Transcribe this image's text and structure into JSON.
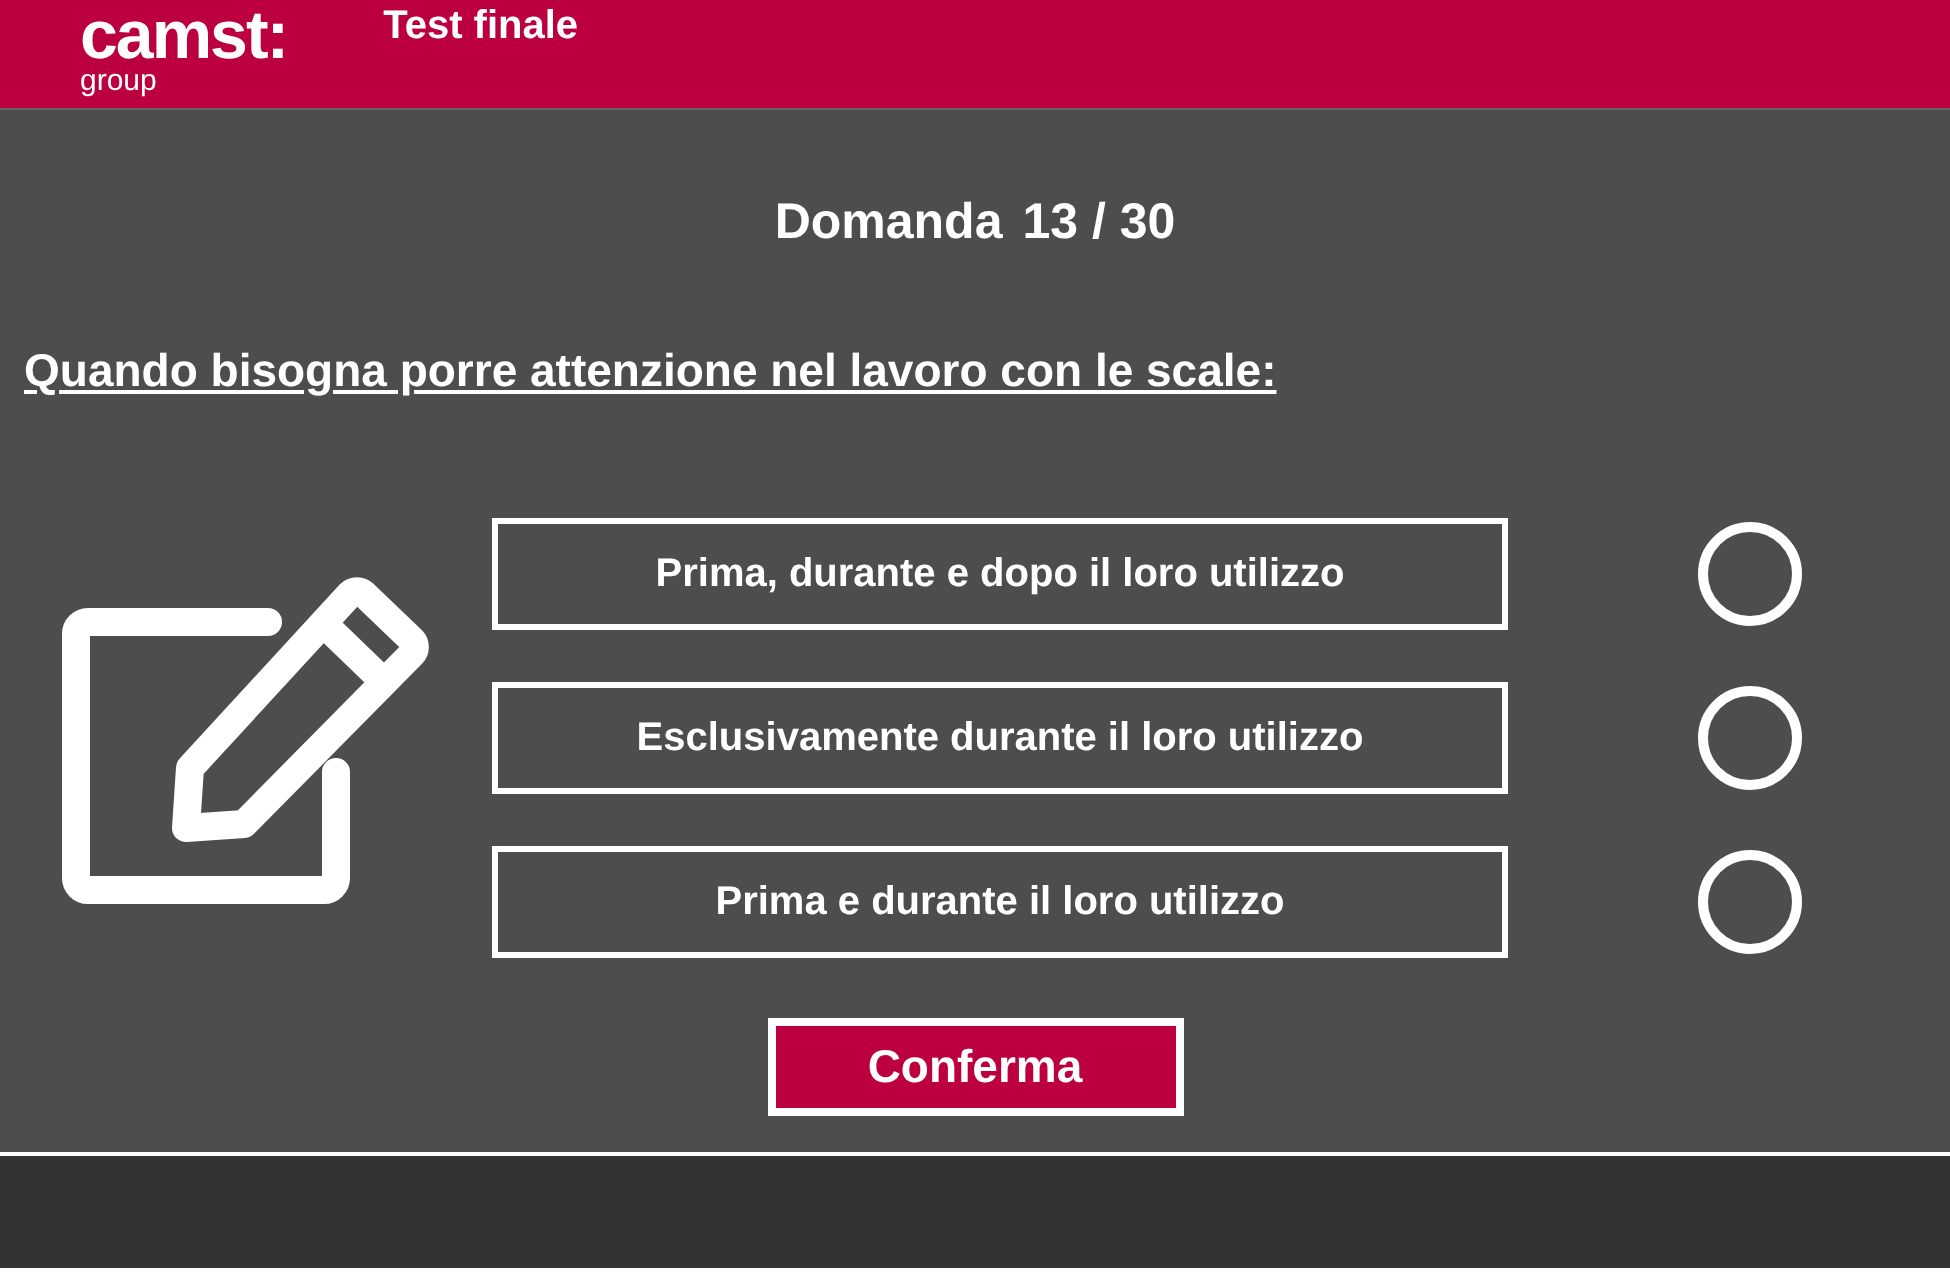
{
  "header": {
    "logo": "camst:",
    "logo_sub": "group",
    "title": "Test finale"
  },
  "question_counter": {
    "label": "Domanda",
    "value": "13 / 30"
  },
  "question": "Quando bisogna porre attenzione nel lavoro con le scale:",
  "answers": [
    {
      "text": "Prima, durante e dopo il loro utilizzo",
      "selected": false
    },
    {
      "text": "Esclusivamente durante il loro utilizzo",
      "selected": false
    },
    {
      "text": "Prima e durante il loro utilizzo",
      "selected": false
    }
  ],
  "confirm_button": "Conferma"
}
